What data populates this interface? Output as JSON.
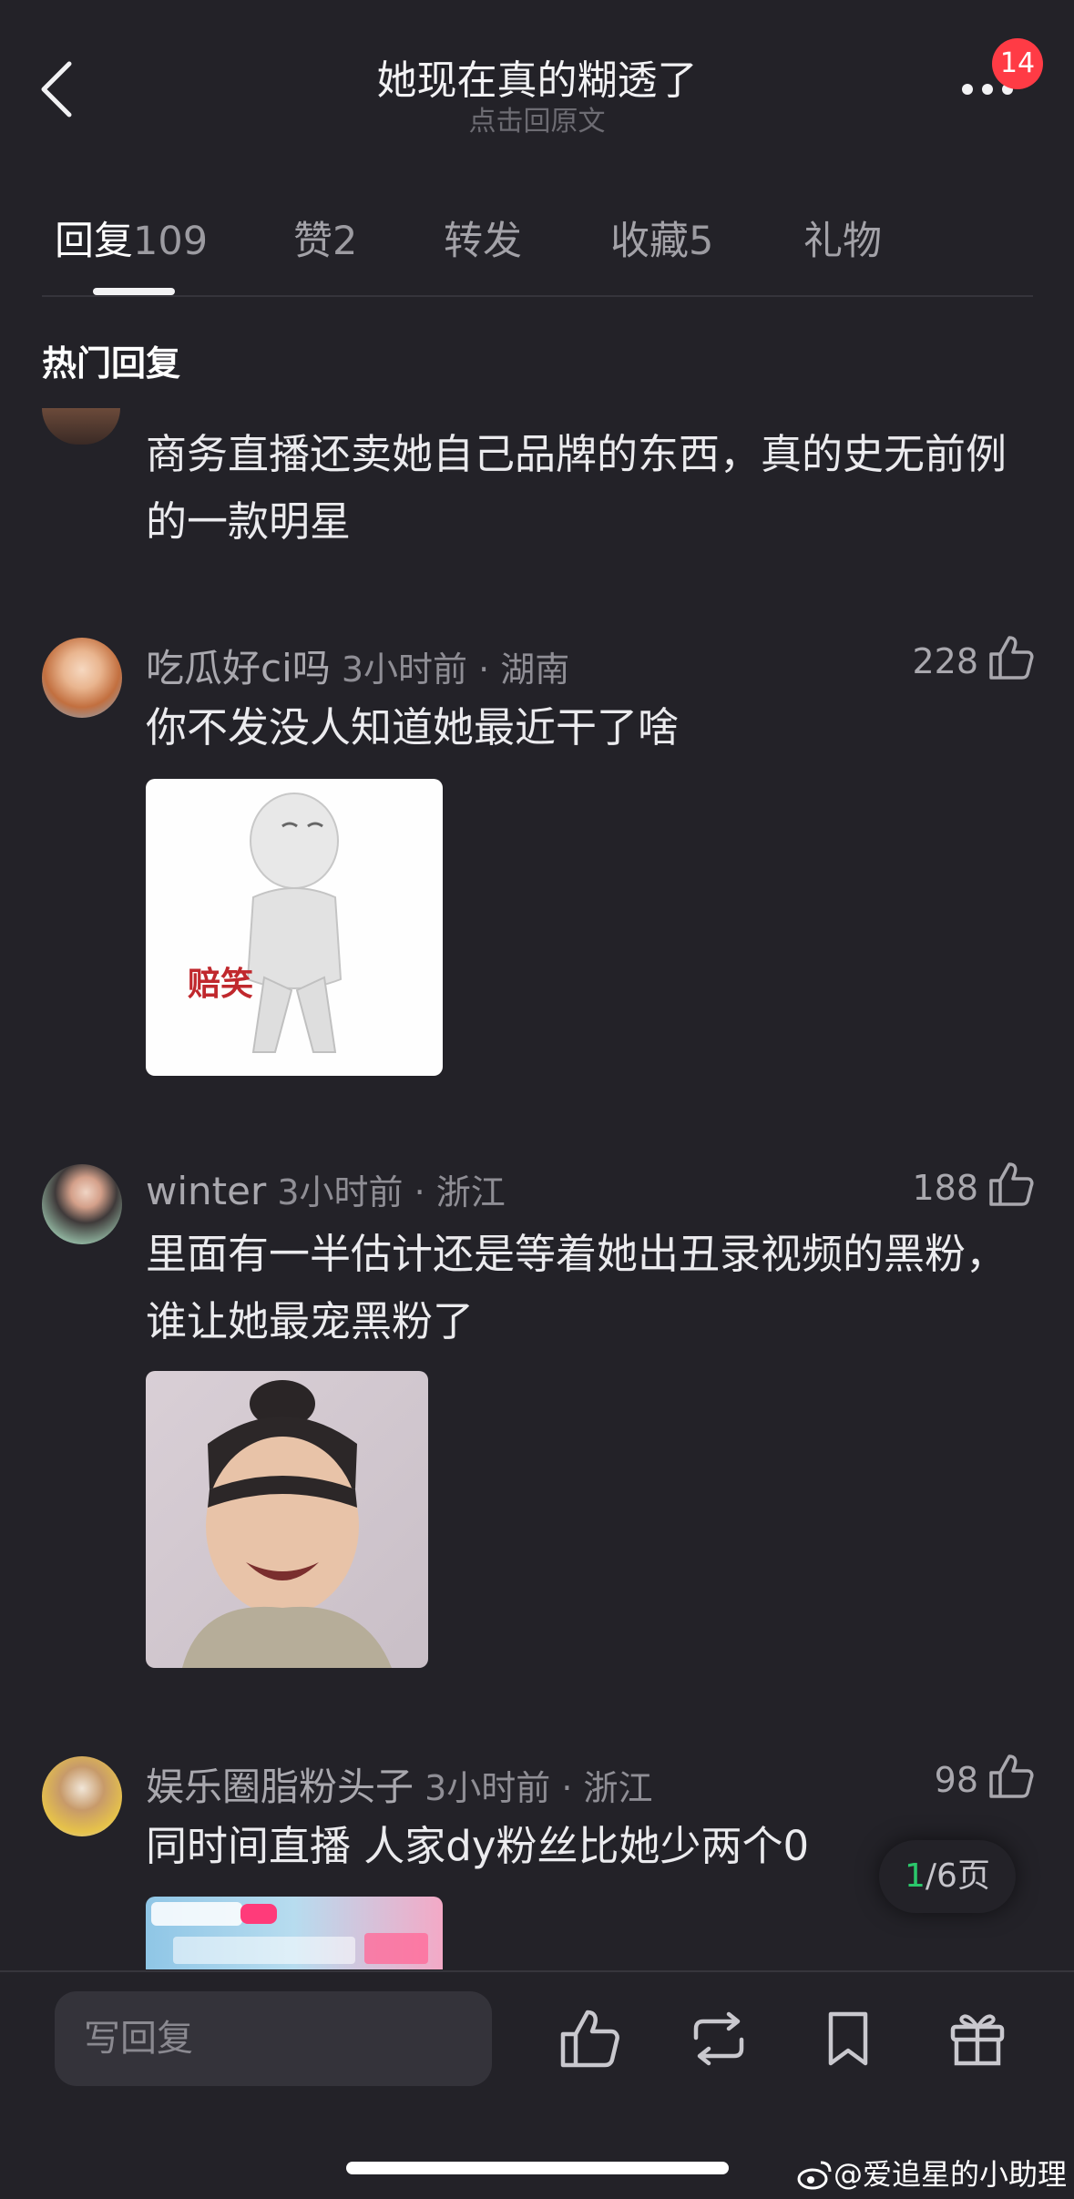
{
  "header": {
    "title": "她现在真的糊透了",
    "subtitle": "点击回原文",
    "notification_badge": "14"
  },
  "tabs": [
    {
      "label": "回复",
      "count": "109",
      "active": true
    },
    {
      "label": "赞",
      "count": "2",
      "active": false
    },
    {
      "label": "转发",
      "count": "",
      "active": false
    },
    {
      "label": "收藏",
      "count": "5",
      "active": false
    },
    {
      "label": "礼物",
      "count": "",
      "active": false
    }
  ],
  "section_title": "热门回复",
  "comments": [
    {
      "text": "商务直播还卖她自己品牌的东西，真的史无前例的一款明星"
    },
    {
      "username": "吃瓜好ci吗",
      "time": "3小时前",
      "location": "湖南",
      "likes": "228",
      "text": "你不发没人知道她最近干了啥",
      "image_caption": "赔笑"
    },
    {
      "username": "winter",
      "time": "3小时前",
      "location": "浙江",
      "likes": "188",
      "text": "里面有一半估计还是等着她出丑录视频的黑粉，谁让她最宠黑粉了"
    },
    {
      "username": "娱乐圈脂粉头子",
      "time": "3小时前",
      "location": "浙江",
      "likes": "98",
      "text": "同时间直播 人家dy粉丝比她少两个0"
    }
  ],
  "pagination": {
    "current": "1",
    "total_label": "/6页"
  },
  "bottom_bar": {
    "reply_placeholder": "写回复"
  },
  "watermark": "@爱追星的小助理",
  "icons": [
    "back-icon",
    "more-icon",
    "like-icon",
    "repost-icon",
    "bookmark-icon",
    "gift-icon",
    "weibo-icon"
  ],
  "colors": {
    "background": "#232228",
    "badge": "#ff3b45",
    "page_current": "#2bc76b"
  }
}
